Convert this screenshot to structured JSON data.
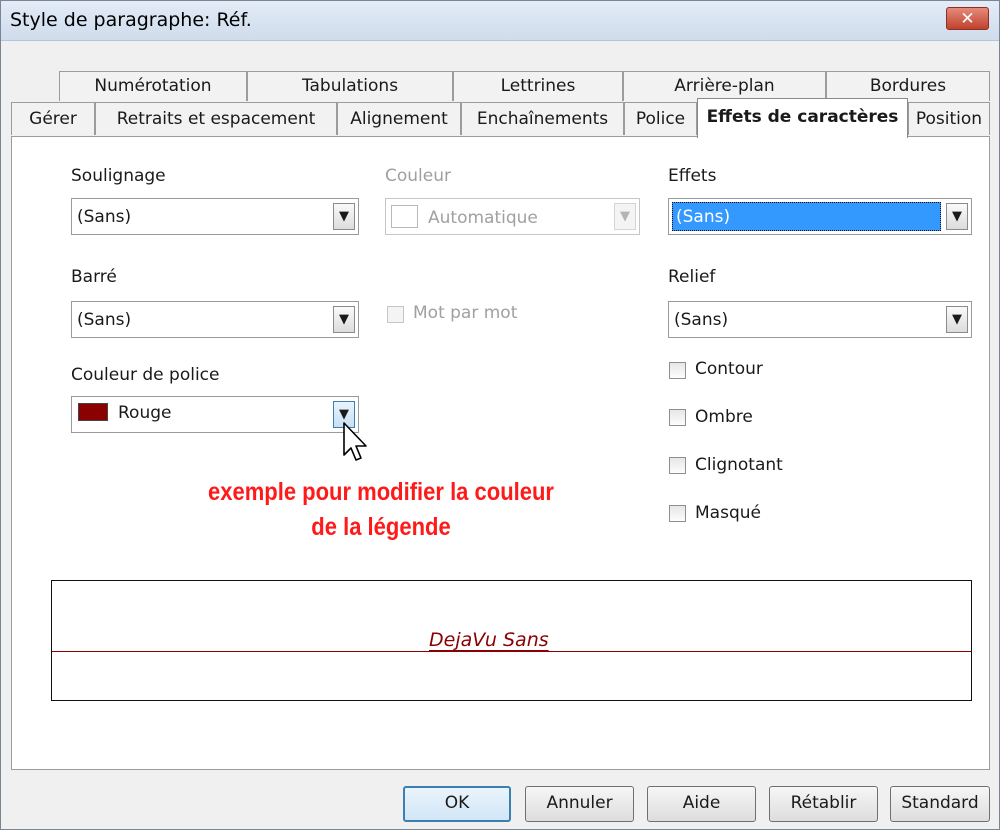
{
  "window": {
    "title": "Style de paragraphe: Réf.",
    "close_glyph": "✕"
  },
  "tabs_row1": [
    "Numérotation",
    "Tabulations",
    "Lettrines",
    "Arrière-plan",
    "Bordures"
  ],
  "tabs_row2": [
    "Gérer",
    "Retraits et espacement",
    "Alignement",
    "Enchaînements",
    "Police",
    "Effets de caractères",
    "Position"
  ],
  "active_tab": "Effets de caractères",
  "left": {
    "underline": {
      "label": "Soulignage",
      "value": "(Sans)"
    },
    "strike": {
      "label": "Barré",
      "value": "(Sans)"
    },
    "font_color": {
      "label": "Couleur de police",
      "value": "Rouge",
      "swatch": "#8b0000"
    }
  },
  "middle": {
    "color": {
      "label": "Couleur",
      "value": "Automatique"
    },
    "word_by_word": {
      "label": "Mot par mot",
      "checked": false
    }
  },
  "right": {
    "effects": {
      "label": "Effets",
      "value": "(Sans)"
    },
    "relief": {
      "label": "Relief",
      "value": "(Sans)"
    },
    "checkboxes": [
      "Contour",
      "Ombre",
      "Clignotant",
      "Masqué"
    ]
  },
  "annotation": {
    "line1": "exemple pour modifier la couleur",
    "line2": "de la légende",
    "color": "#ff1a1a"
  },
  "preview": {
    "text": "DejaVu Sans",
    "color": "#8b0000"
  },
  "buttons": {
    "ok": "OK",
    "cancel": "Annuler",
    "help": "Aide",
    "reset": "Rétablir",
    "standard": "Standard"
  },
  "icons": {
    "dropdown": "▼"
  }
}
